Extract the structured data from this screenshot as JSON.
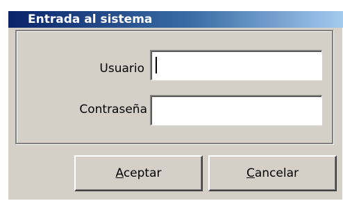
{
  "window": {
    "title": "Entrada al sistema"
  },
  "form": {
    "user_label": "Usuario",
    "user_value": "",
    "password_label": "Contraseña",
    "password_value": ""
  },
  "buttons": {
    "accept_mnemonic": "A",
    "accept_rest": "ceptar",
    "cancel_mnemonic": "C",
    "cancel_rest": "ancelar"
  },
  "colors": {
    "title_start": "#0a246a",
    "title_end": "#a6caf0",
    "face": "#d4d0c8"
  }
}
